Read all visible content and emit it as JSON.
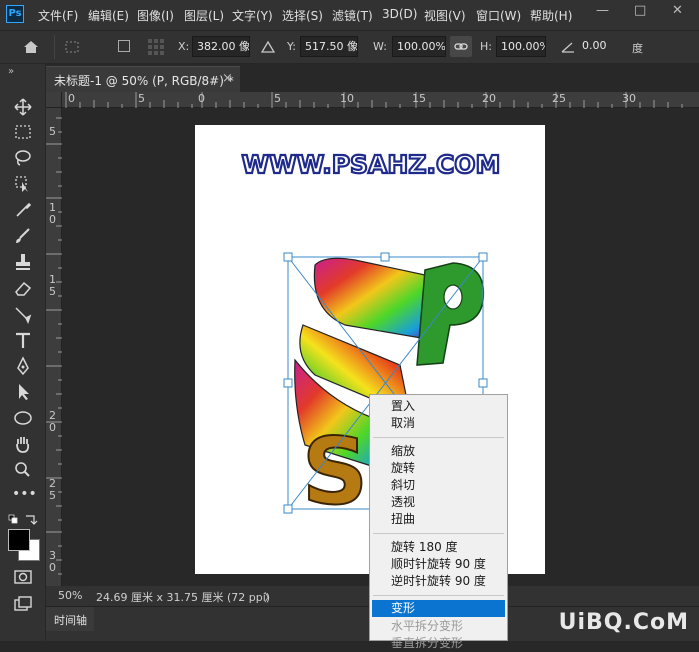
{
  "app": {
    "logo": "Ps",
    "menu": [
      "文件(F)",
      "编辑(E)",
      "图像(I)",
      "图层(L)",
      "文字(Y)",
      "选择(S)",
      "滤镜(T)",
      "3D(D)",
      "视图(V)",
      "窗口(W)",
      "帮助(H)"
    ],
    "window_controls": [
      "—",
      "□",
      "✕"
    ]
  },
  "options": {
    "x_label": "X:",
    "x_value": "382.00 像",
    "y_label": "Y:",
    "y_value": "517.50 像",
    "w_label": "W:",
    "w_value": "100.00%",
    "h_label": "H:",
    "h_value": "100.00%",
    "angle_value": "0.00",
    "angle_unit": "度"
  },
  "document": {
    "tab_title": "未标题-1 @ 50% (P, RGB/8#) *",
    "tab_close": "×",
    "panel_collapse": "»",
    "artwork_text": "WWW.PSAHZ.COM",
    "letter_p": "P",
    "letter_s": "S"
  },
  "rulers": {
    "top": [
      "0",
      "5",
      "0",
      "5",
      "10",
      "15",
      "20",
      "25",
      "30"
    ],
    "left": [
      "5",
      "1\n0",
      "1\n5",
      "2\n0",
      "2\n5",
      "3\n0"
    ]
  },
  "status": {
    "zoom": "50%",
    "doc_size": "24.69 厘米 x 31.75 厘米 (72 ppi)",
    "arrow": "〉",
    "timeline": "时间轴"
  },
  "context_menu": {
    "group1": [
      "置入",
      "取消"
    ],
    "group2": [
      "缩放",
      "旋转",
      "斜切",
      "透视",
      "扭曲"
    ],
    "group3": [
      "旋转 180 度",
      "顺时针旋转 90 度",
      "逆时针旋转 90 度"
    ],
    "selected": "变形",
    "disabled": [
      "水平拆分变形",
      "垂直拆分变形"
    ]
  },
  "watermark": "UiBQ.CoM",
  "colors": {
    "selection": "#0a74d0",
    "transform_box": "#3a88c8",
    "brand": "#31a8ff"
  }
}
